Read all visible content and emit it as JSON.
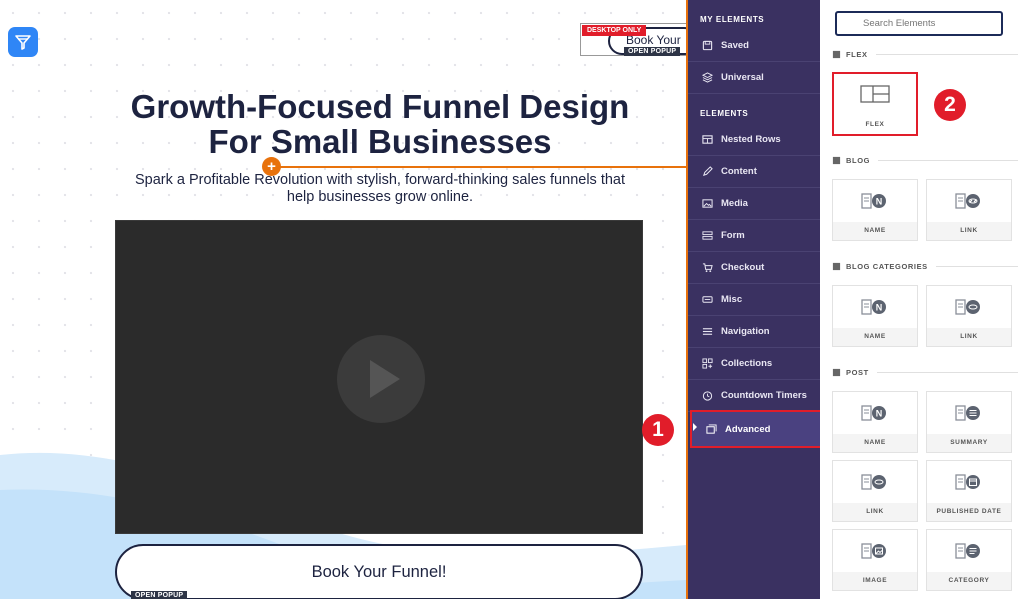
{
  "canvas": {
    "desktop_only_badge": "DESKTOP ONLY",
    "top_book_button_label": "Book Your",
    "open_popup_tag": "OPEN POPUP",
    "hero_title_line1": "Growth-Focused Funnel Design",
    "hero_title_line2": "For Small Businesses",
    "subtitle_line1": "Spark a Profitable Revolution with stylish, forward-thinking sales funnels that",
    "subtitle_line2": "help businesses grow online.",
    "cta_label": "Book Your Funnel!",
    "bottom_popup_tag": "OPEN POPUP"
  },
  "left_panel": {
    "my_elements_heading": "MY ELEMENTS",
    "my_elements": [
      {
        "label": "Saved",
        "icon": "saved-icon"
      },
      {
        "label": "Universal",
        "icon": "universal-icon"
      }
    ],
    "elements_heading": "ELEMENTS",
    "elements": [
      {
        "label": "Nested Rows",
        "icon": "nested-rows-icon"
      },
      {
        "label": "Content",
        "icon": "pen-icon"
      },
      {
        "label": "Media",
        "icon": "media-icon"
      },
      {
        "label": "Form",
        "icon": "form-icon"
      },
      {
        "label": "Checkout",
        "icon": "cart-icon"
      },
      {
        "label": "Misc",
        "icon": "misc-icon"
      },
      {
        "label": "Navigation",
        "icon": "menu-icon"
      },
      {
        "label": "Collections",
        "icon": "collections-icon"
      },
      {
        "label": "Countdown Timers",
        "icon": "timer-icon"
      },
      {
        "label": "Advanced",
        "icon": "advanced-icon",
        "active": true
      }
    ]
  },
  "right_panel": {
    "search_placeholder": "Search Elements",
    "flex_group": "FLEX",
    "flex_card": "FLEX",
    "blog_group": "BLOG",
    "blog_cards": [
      "NAME",
      "LINK"
    ],
    "blog_categories_group": "BLOG CATEGORIES",
    "blog_categories_cards": [
      "NAME",
      "LINK"
    ],
    "post_group": "POST",
    "post_cards": [
      "NAME",
      "SUMMARY",
      "LINK",
      "PUBLISHED DATE",
      "IMAGE",
      "CATEGORY"
    ]
  },
  "steps": [
    "1",
    "2"
  ],
  "colors": {
    "sidebar_bg": "#3a3161",
    "accent_orange": "#e8720c",
    "highlight_red": "#e11d2a",
    "heading_navy": "#1d2340"
  }
}
